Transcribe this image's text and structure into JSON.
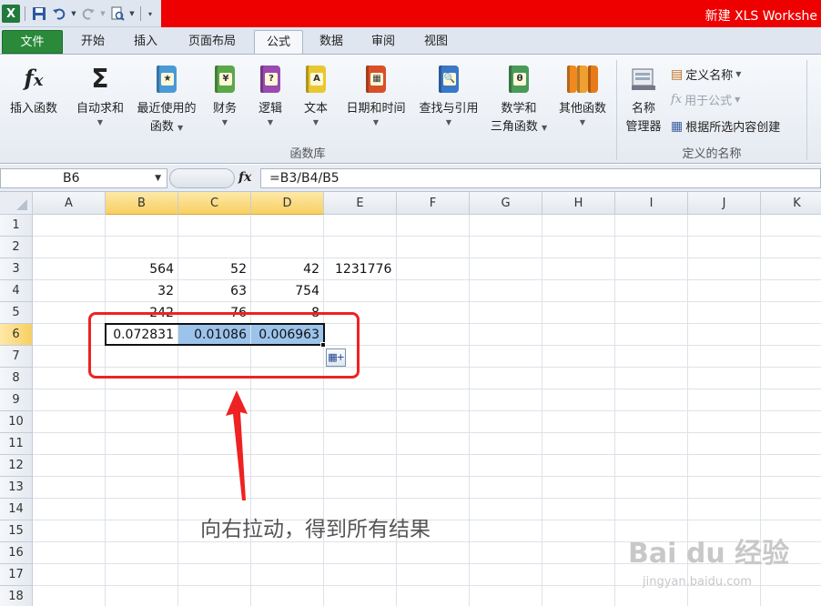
{
  "titlebar": {
    "title": "新建 XLS Workshe",
    "logo": "X"
  },
  "tabs": [
    "文件",
    "开始",
    "插入",
    "页面布局",
    "公式",
    "数据",
    "审阅",
    "视图"
  ],
  "ribbon": {
    "insert_function": "插入函数",
    "autosum": "自动求和",
    "recent_1": "最近使用的",
    "recent_2": "函数",
    "financial": "财务",
    "logical": "逻辑",
    "text": "文本",
    "datetime": "日期和时间",
    "lookup": "查找与引用",
    "math_1": "数学和",
    "math_2": "三角函数",
    "more": "其他函数",
    "function_library": "函数库",
    "name_manager_1": "名称",
    "name_manager_2": "管理器",
    "define_name": "定义名称",
    "use_in_formula": "用于公式",
    "create_from_selection": "根据所选内容创建",
    "defined_names": "定义的名称"
  },
  "formula_bar": {
    "name_box": "B6",
    "formula": "=B3/B4/B5",
    "fx": "fx"
  },
  "columns": [
    "A",
    "B",
    "C",
    "D",
    "E",
    "F",
    "G",
    "H",
    "I",
    "J",
    "K"
  ],
  "rows": [
    "1",
    "2",
    "3",
    "4",
    "5",
    "6",
    "7",
    "8",
    "9",
    "10",
    "11",
    "12",
    "13",
    "14",
    "15",
    "16",
    "17",
    "18"
  ],
  "cells": {
    "B3": "564",
    "C3": "52",
    "D3": "42",
    "E3": "1231776",
    "B4": "32",
    "C4": "63",
    "D4": "754",
    "B5": "242",
    "C5": "76",
    "D5": "8",
    "B6": "0.072831",
    "C6": "0.01086",
    "D6": "0.006963"
  },
  "annotation": "向右拉动，得到所有结果",
  "watermark": {
    "logo": "Bai du 经验",
    "url": "jingyan.baidu.com"
  },
  "colors": {
    "accent_red": "#ee0000",
    "file_tab": "#2a8a3a",
    "selection": "#9cc3ec",
    "annotation_red": "#ee2222"
  }
}
